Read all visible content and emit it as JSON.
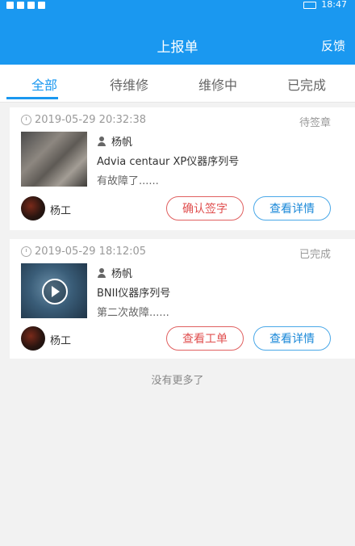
{
  "status_bar": {
    "time": "18:47"
  },
  "header": {
    "title": "上报单",
    "feedback": "反馈"
  },
  "tabs": [
    {
      "label": "全部",
      "active": true
    },
    {
      "label": "待维修",
      "active": false
    },
    {
      "label": "维修中",
      "active": false
    },
    {
      "label": "已完成",
      "active": false
    }
  ],
  "cards": [
    {
      "time": "2019-05-29 20:32:38",
      "status": "待签章",
      "reporter": "杨帆",
      "device": "Advia centaur XP仪器序列号",
      "note": "有故障了......",
      "technician": "杨工",
      "action_label": "确认签字",
      "detail_label": "查看详情"
    },
    {
      "time": "2019-05-29 18:12:05",
      "status": "已完成",
      "reporter": "杨帆",
      "device": "BNII仪器序列号",
      "note": "第二次故障......",
      "technician": "杨工",
      "action_label": "查看工单",
      "detail_label": "查看详情"
    }
  ],
  "footer": {
    "no_more": "没有更多了"
  },
  "colors": {
    "primary": "#1a98f0",
    "danger": "#e05050",
    "background": "#f2f2f2"
  }
}
